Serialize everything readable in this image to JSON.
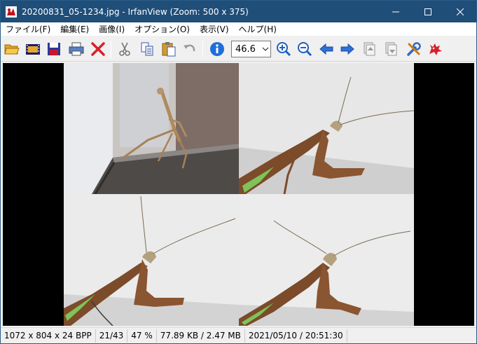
{
  "window": {
    "title": "20200831_05-1234.jpg - IrfanView (Zoom: 500 x 375)"
  },
  "menu": {
    "items": [
      {
        "label": "ファイル(F)"
      },
      {
        "label": "編集(E)"
      },
      {
        "label": "画像(I)"
      },
      {
        "label": "オプション(O)"
      },
      {
        "label": "表示(V)"
      },
      {
        "label": "ヘルプ(H)"
      }
    ]
  },
  "toolbar": {
    "zoom_value": "46.6",
    "icons": [
      "open-folder-icon",
      "slideshow-icon",
      "save-icon",
      "print-icon",
      "delete-icon",
      "cut-icon",
      "copy-icon",
      "paste-icon",
      "undo-icon",
      "info-icon",
      "zoom-in-icon",
      "zoom-out-icon",
      "previous-icon",
      "next-icon",
      "first-page-icon",
      "last-page-icon",
      "settings-icon",
      "irfanview-logo-icon"
    ]
  },
  "status": {
    "dimensions": "1072 x 804 x 24 BPP",
    "index": "21/43",
    "zoom": "47 %",
    "size": "77.89 KB / 2.47 MB",
    "datetime": "2021/05/10 / 20:51:30"
  },
  "colors": {
    "titlebar": "#1f4e79",
    "background": "#000000",
    "accent_blue": "#1e6fd9"
  }
}
